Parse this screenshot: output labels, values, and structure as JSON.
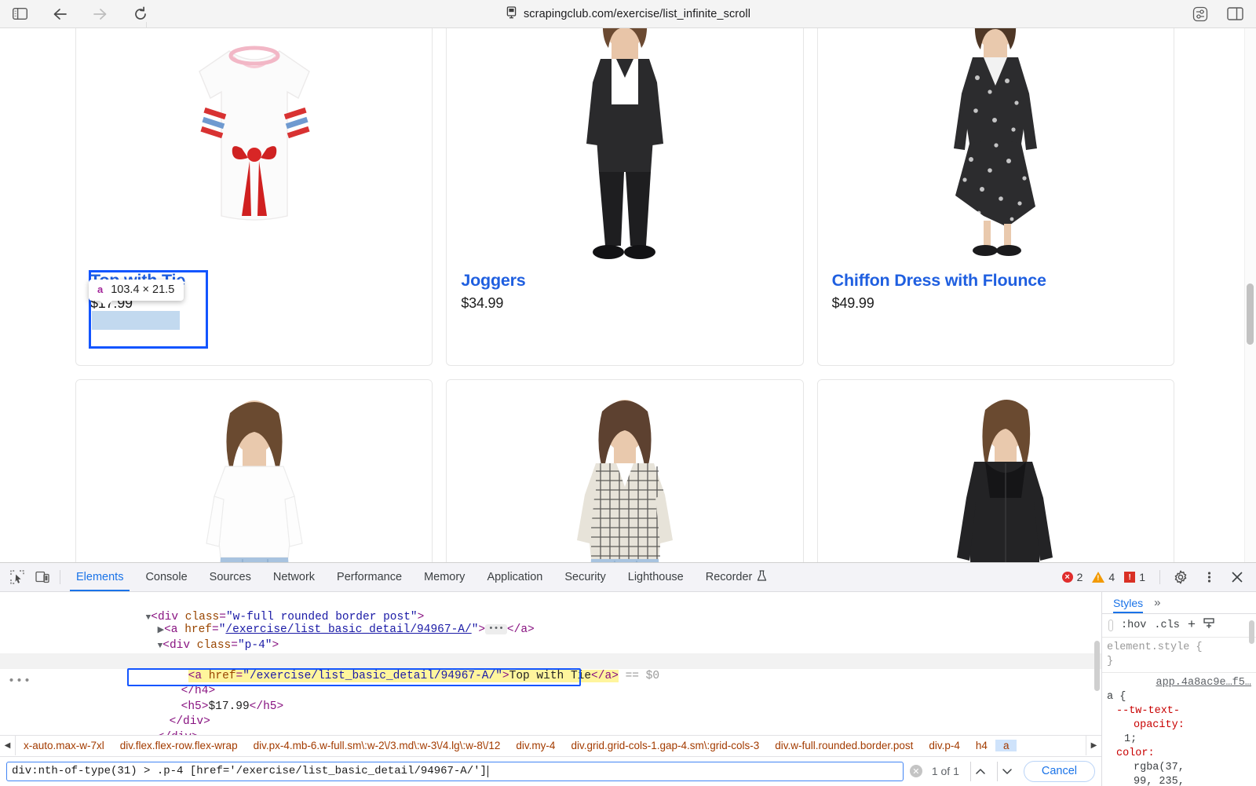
{
  "browser": {
    "url": "scrapingclub.com/exercise/list_infinite_scroll",
    "icons": {
      "sidebar": "sidebar-icon",
      "back": "back-arrow-icon",
      "forward": "forward-arrow-icon",
      "reload": "reload-icon",
      "shield": "shield-icon",
      "format": "page-settings-icon",
      "tabs": "tab-overview-icon"
    }
  },
  "page": {
    "products": [
      {
        "title": "Top with Tie",
        "price": "$17.99"
      },
      {
        "title": "Joggers",
        "price": "$34.99"
      },
      {
        "title": "Chiffon Dress with Flounce",
        "price": "$49.99"
      },
      {
        "title": "",
        "price": ""
      },
      {
        "title": "",
        "price": ""
      },
      {
        "title": "",
        "price": ""
      }
    ]
  },
  "inspector_tooltip": {
    "tag": "a",
    "dimensions": "103.4 × 21.5"
  },
  "devtools": {
    "tabs": [
      "Elements",
      "Console",
      "Sources",
      "Network",
      "Performance",
      "Memory",
      "Application",
      "Security",
      "Lighthouse",
      "Recorder"
    ],
    "active_tab": "Elements",
    "status": {
      "errors": "2",
      "warnings": "4",
      "issues": "1"
    },
    "icons": {
      "inspect": "inspect-cursor-icon",
      "device": "device-toolbar-icon",
      "recorder_flask": "flask-icon",
      "settings": "gear-icon",
      "more": "kebab-menu-icon",
      "close": "close-icon"
    },
    "dom": {
      "lines": [
        {
          "indent": 3,
          "triangle": "down",
          "content": "div_open"
        },
        {
          "indent": 4,
          "triangle": "right",
          "content": "a_collapsed"
        },
        {
          "indent": 4,
          "triangle": "down",
          "content": "p4_open"
        },
        {
          "indent": 5,
          "triangle": "down",
          "content": "h4_open"
        },
        {
          "indent": 6,
          "triangle": "none",
          "content": "a_selected"
        },
        {
          "indent": 5,
          "triangle": "none",
          "content": "h4_close"
        },
        {
          "indent": 5,
          "triangle": "none",
          "content": "h5_line"
        },
        {
          "indent": 4,
          "triangle": "none",
          "content": "div_close"
        },
        {
          "indent": 3,
          "triangle": "none",
          "content": "div_close2"
        }
      ],
      "div_class": "w-full rounded border post",
      "anchor_href": "/exercise/list_basic_detail/94967-A/",
      "p4_class": "p-4",
      "selected_text": "Top with Tie",
      "selected_marker": "== $0",
      "price_text": "$17.99",
      "ellipsis": "•••",
      "left_dots": "•••"
    },
    "breadcrumb": {
      "items": [
        "x-auto.max-w-7xl",
        "div.flex.flex-row.flex-wrap",
        "div.px-4.mb-6.w-full.sm\\:w-2\\/3.md\\:w-3\\/4.lg\\:w-8\\/12",
        "div.my-4",
        "div.grid.grid-cols-1.gap-4.sm\\:grid-cols-3",
        "div.w-full.rounded.border.post",
        "div.p-4",
        "h4",
        "a"
      ],
      "selected_index": 8
    },
    "search": {
      "value": "div:nth-of-type(31) > .p-4 [href='/exercise/list_basic_detail/94967-A/']",
      "count": "1 of 1",
      "cancel_label": "Cancel",
      "prev_icon": "chevron-up-icon",
      "next_icon": "chevron-down-icon",
      "clear_icon": "clear-icon"
    },
    "styles": {
      "tab_label": "Styles",
      "more_label": "»",
      "toolbar": {
        "hov": ":hov",
        "cls": ".cls",
        "plus": "+",
        "new_style_rule": "new-style-rule-icon"
      },
      "element_style": "element.style {",
      "element_style_close": "}",
      "source_link": "app.4a8ac9e…f5…",
      "selector": "a {",
      "props": [
        {
          "name": "--tw-text-",
          "cont": "opacity:",
          "value": "1;"
        },
        {
          "name": "color:",
          "cont": "rgba(37,",
          "value": "99, 235,"
        }
      ]
    }
  }
}
